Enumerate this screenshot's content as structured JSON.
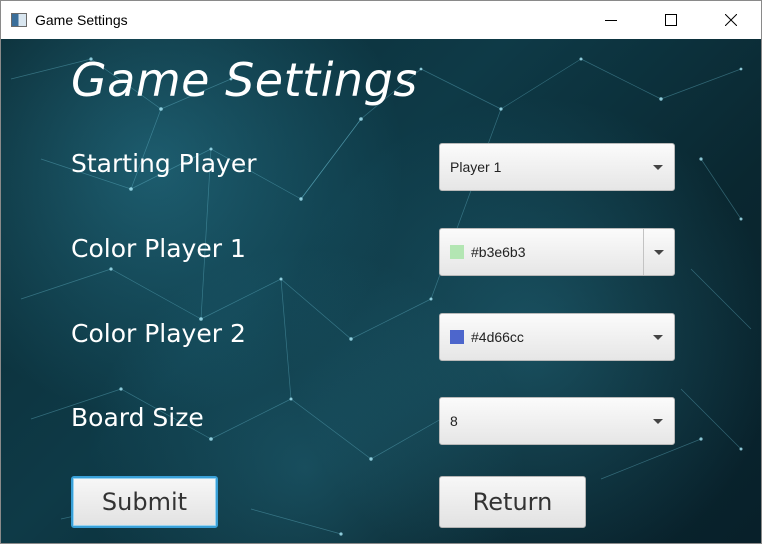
{
  "window": {
    "title": "Game Settings"
  },
  "heading": "Game Settings",
  "fields": {
    "starting_player": {
      "label": "Starting Player",
      "value": "Player 1"
    },
    "color_player_1": {
      "label": "Color Player 1",
      "value": "#b3e6b3",
      "swatch_color": "#b3e6b3"
    },
    "color_player_2": {
      "label": "Color Player 2",
      "value": "#4d66cc",
      "swatch_color": "#4d66cc"
    },
    "board_size": {
      "label": "Board Size",
      "value": "8"
    }
  },
  "buttons": {
    "submit": "Submit",
    "return": "Return"
  },
  "icons": {
    "window": [
      "minimize-icon",
      "maximize-icon",
      "close-icon"
    ],
    "combo": "chevron-down-icon"
  },
  "colors": {
    "background": "#0c3440",
    "text": "#ffffff",
    "focus": "#39a0d8"
  }
}
